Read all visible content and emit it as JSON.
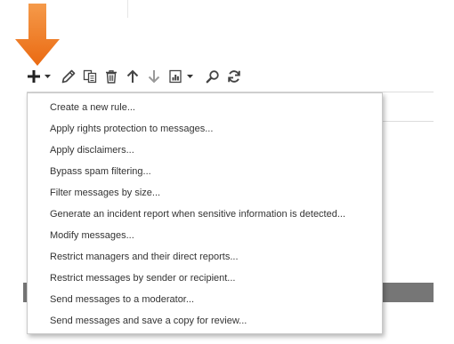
{
  "toolbar": {
    "icons": [
      "plus-icon",
      "chevron-down-icon",
      "pencil-icon",
      "copy-icon",
      "trash-icon",
      "arrow-up-icon",
      "arrow-down-icon",
      "report-icon",
      "chevron-down-icon",
      "search-icon",
      "refresh-icon"
    ]
  },
  "menu": {
    "items": [
      {
        "label": "Create a new rule..."
      },
      {
        "label": "Apply rights protection to messages..."
      },
      {
        "label": "Apply disclaimers..."
      },
      {
        "label": "Bypass spam filtering..."
      },
      {
        "label": "Filter messages by size..."
      },
      {
        "label": "Generate an incident report when sensitive information is detected..."
      },
      {
        "label": "Modify messages..."
      },
      {
        "label": "Restrict managers and their direct reports..."
      },
      {
        "label": "Restrict messages by sender or recipient..."
      },
      {
        "label": "Send messages to a moderator..."
      },
      {
        "label": "Send messages and save a copy for review..."
      }
    ]
  },
  "colors": {
    "arrow": "#f07c22",
    "icon": "#444444",
    "menu_border": "#c8c8c8",
    "bar": "#767676"
  }
}
